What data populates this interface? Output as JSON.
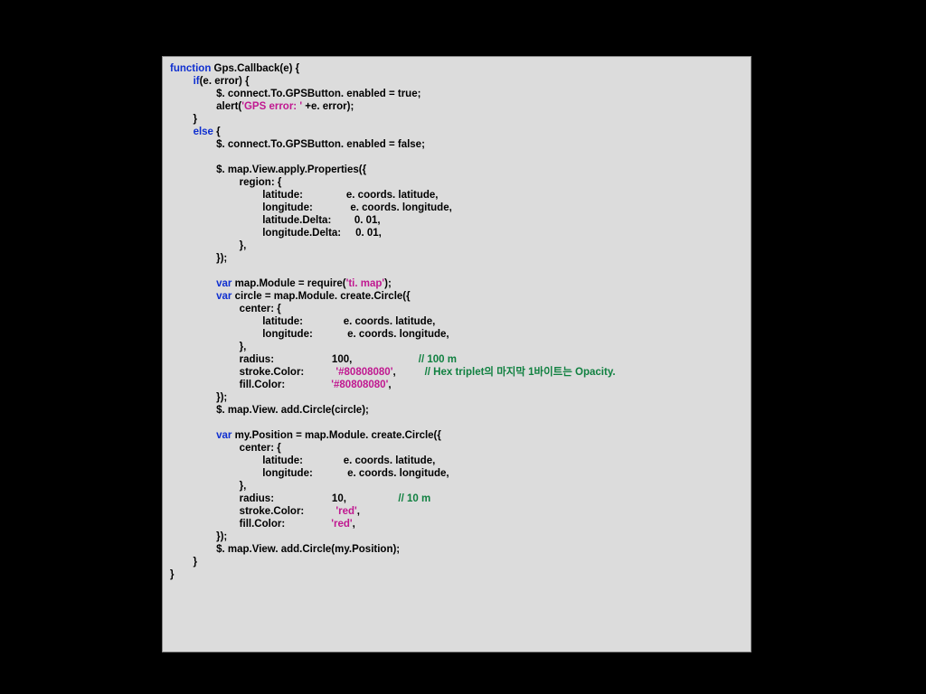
{
  "code": {
    "tokens": [
      {
        "t": "kw",
        "v": "function"
      },
      {
        "t": "p",
        "v": " Gps.Callback(e) {\n"
      },
      {
        "t": "p",
        "v": "        "
      },
      {
        "t": "kw",
        "v": "if"
      },
      {
        "t": "p",
        "v": "(e. error) {\n"
      },
      {
        "t": "p",
        "v": "                $. connect.To.GPSButton. enabled = true;\n"
      },
      {
        "t": "p",
        "v": "                alert("
      },
      {
        "t": "str",
        "v": "'GPS error: '"
      },
      {
        "t": "p",
        "v": " +e. error);\n"
      },
      {
        "t": "p",
        "v": "        }\n"
      },
      {
        "t": "p",
        "v": "        "
      },
      {
        "t": "kw",
        "v": "else"
      },
      {
        "t": "p",
        "v": " {\n"
      },
      {
        "t": "p",
        "v": "                $. connect.To.GPSButton. enabled = false;\n"
      },
      {
        "t": "p",
        "v": "\n"
      },
      {
        "t": "p",
        "v": "                $. map.View.apply.Properties({\n"
      },
      {
        "t": "p",
        "v": "                        region: {\n"
      },
      {
        "t": "p",
        "v": "                                latitude:               e. coords. latitude,\n"
      },
      {
        "t": "p",
        "v": "                                longitude:             e. coords. longitude,\n"
      },
      {
        "t": "p",
        "v": "                                latitude.Delta:        0. 01,\n"
      },
      {
        "t": "p",
        "v": "                                longitude.Delta:     0. 01,\n"
      },
      {
        "t": "p",
        "v": "                        },\n"
      },
      {
        "t": "p",
        "v": "                });\n"
      },
      {
        "t": "p",
        "v": "\n"
      },
      {
        "t": "p",
        "v": "                "
      },
      {
        "t": "kw",
        "v": "var"
      },
      {
        "t": "p",
        "v": " map.Module = require("
      },
      {
        "t": "str",
        "v": "'ti. map'"
      },
      {
        "t": "p",
        "v": ");\n"
      },
      {
        "t": "p",
        "v": "                "
      },
      {
        "t": "kw",
        "v": "var"
      },
      {
        "t": "p",
        "v": " circle = map.Module. create.Circle({\n"
      },
      {
        "t": "p",
        "v": "                        center: {\n"
      },
      {
        "t": "p",
        "v": "                                latitude:              e. coords. latitude,\n"
      },
      {
        "t": "p",
        "v": "                                longitude:            e. coords. longitude,\n"
      },
      {
        "t": "p",
        "v": "                        },\n"
      },
      {
        "t": "p",
        "v": "                        radius:                    100,                       "
      },
      {
        "t": "cmt",
        "v": "// 100 m"
      },
      {
        "t": "p",
        "v": "\n"
      },
      {
        "t": "p",
        "v": "                        stroke.Color:           "
      },
      {
        "t": "str",
        "v": "'#80808080'"
      },
      {
        "t": "p",
        "v": ",          "
      },
      {
        "t": "cmt",
        "v": "// Hex triplet의 마지막 1바이트는 Opacity."
      },
      {
        "t": "p",
        "v": "\n"
      },
      {
        "t": "p",
        "v": "                        fill.Color:                "
      },
      {
        "t": "str",
        "v": "'#80808080'"
      },
      {
        "t": "p",
        "v": ",\n"
      },
      {
        "t": "p",
        "v": "                });\n"
      },
      {
        "t": "p",
        "v": "                $. map.View. add.Circle(circle);\n"
      },
      {
        "t": "p",
        "v": "\n"
      },
      {
        "t": "p",
        "v": "                "
      },
      {
        "t": "kw",
        "v": "var"
      },
      {
        "t": "p",
        "v": " my.Position = map.Module. create.Circle({\n"
      },
      {
        "t": "p",
        "v": "                        center: {\n"
      },
      {
        "t": "p",
        "v": "                                latitude:              e. coords. latitude,\n"
      },
      {
        "t": "p",
        "v": "                                longitude:            e. coords. longitude,\n"
      },
      {
        "t": "p",
        "v": "                        },\n"
      },
      {
        "t": "p",
        "v": "                        radius:                    10,                  "
      },
      {
        "t": "cmt",
        "v": "// 10 m"
      },
      {
        "t": "p",
        "v": "\n"
      },
      {
        "t": "p",
        "v": "                        stroke.Color:           "
      },
      {
        "t": "str",
        "v": "'red'"
      },
      {
        "t": "p",
        "v": ",\n"
      },
      {
        "t": "p",
        "v": "                        fill.Color:                "
      },
      {
        "t": "str",
        "v": "'red'"
      },
      {
        "t": "p",
        "v": ",\n"
      },
      {
        "t": "p",
        "v": "                });\n"
      },
      {
        "t": "p",
        "v": "                $. map.View. add.Circle(my.Position);\n"
      },
      {
        "t": "p",
        "v": "        }\n"
      },
      {
        "t": "p",
        "v": "}\n"
      }
    ]
  }
}
